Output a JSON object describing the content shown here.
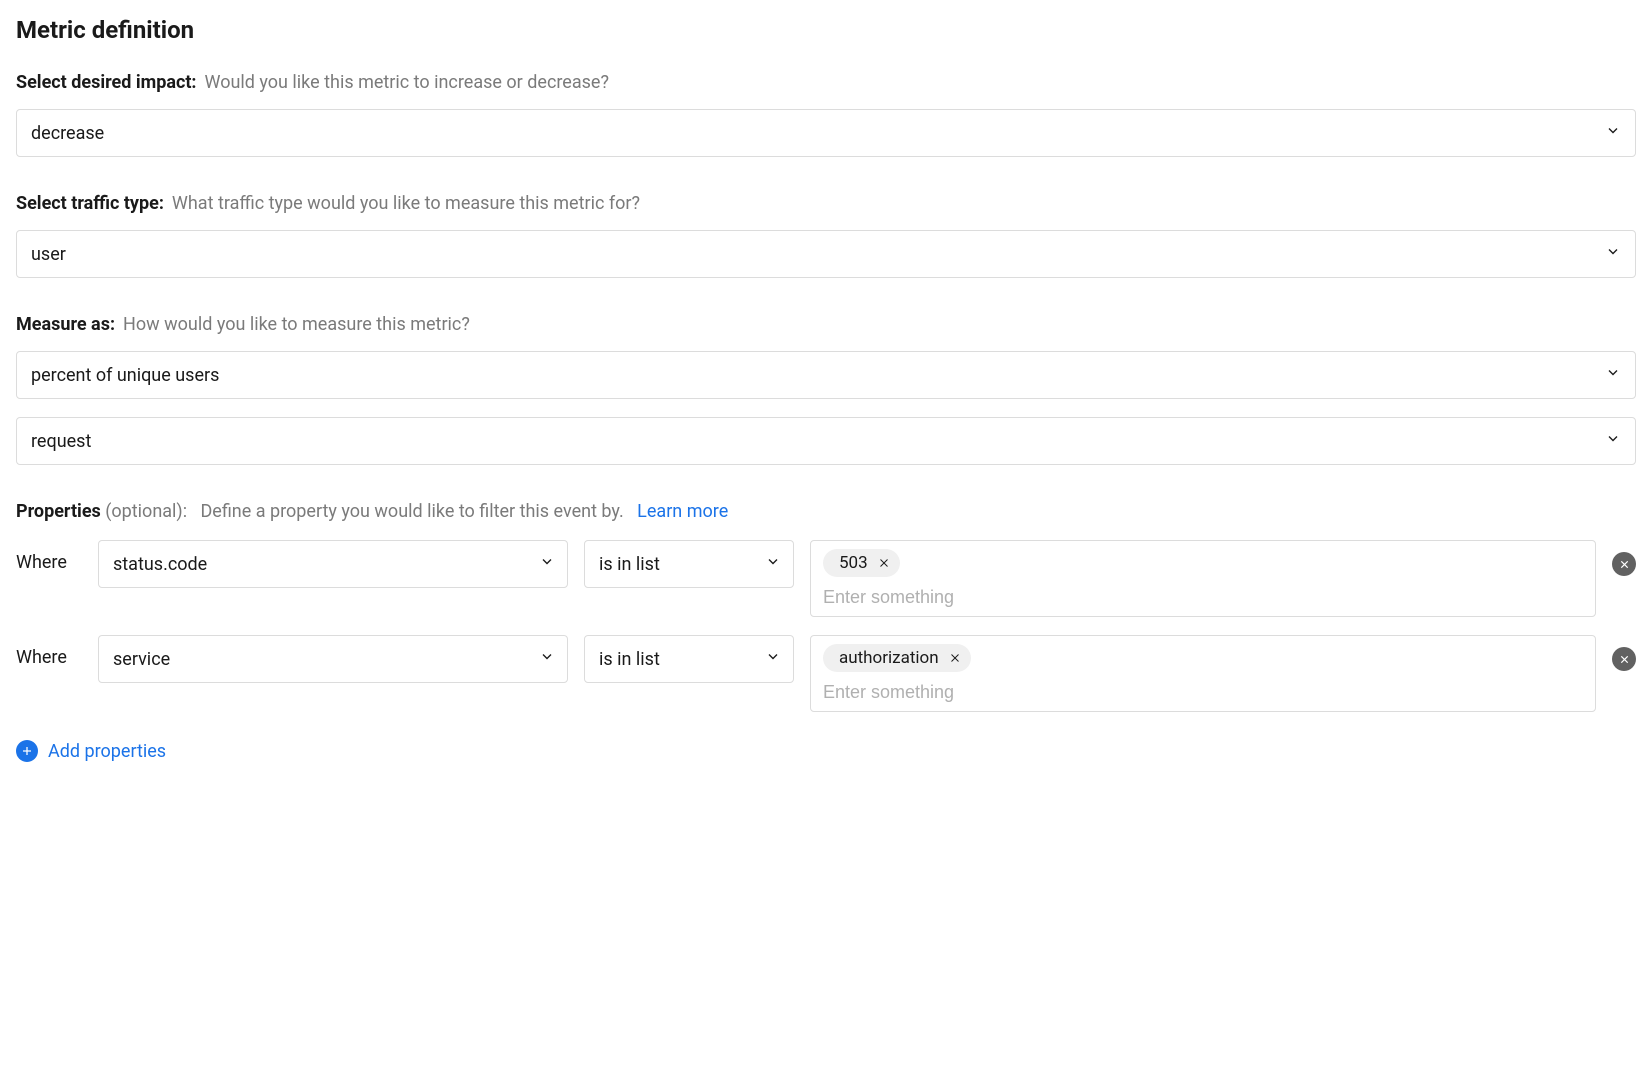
{
  "title": "Metric definition",
  "impact": {
    "label": "Select desired impact:",
    "hint": "Would you like this metric to increase or decrease?",
    "value": "decrease"
  },
  "traffic": {
    "label": "Select traffic type:",
    "hint": "What traffic type would you like to measure this metric for?",
    "value": "user"
  },
  "measure": {
    "label": "Measure as:",
    "hint": "How would you like to measure this metric?",
    "value1": "percent of unique users",
    "value2": "request"
  },
  "properties": {
    "label": "Properties",
    "optional": "(optional):",
    "hint": "Define a property you would like to filter this event by.",
    "learn_more": "Learn more",
    "where_label": "Where",
    "filters": [
      {
        "property": "status.code",
        "operator": "is in list",
        "values": [
          "503"
        ],
        "placeholder": "Enter something"
      },
      {
        "property": "service",
        "operator": "is in list",
        "values": [
          "authorization"
        ],
        "placeholder": "Enter something"
      }
    ],
    "add_label": "Add properties"
  }
}
